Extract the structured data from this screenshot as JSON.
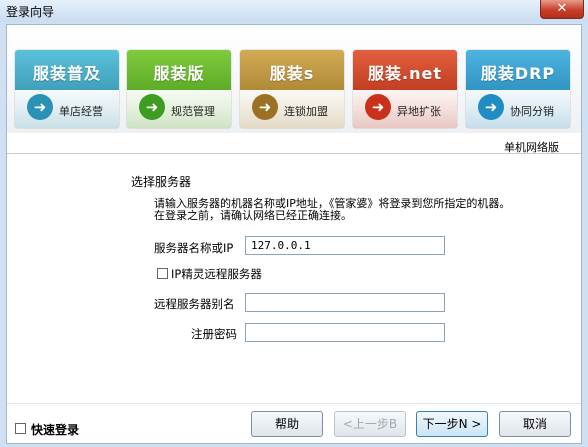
{
  "window": {
    "title": "登录向导",
    "close_glyph": "✕"
  },
  "tiles": [
    {
      "name": "服装普及",
      "sub": "单店经营",
      "color": "#5bc1d9",
      "dark": "#27819f",
      "circle": "#2a93b5"
    },
    {
      "name": "服装版",
      "sub": "规范管理",
      "color": "#7ecb3d",
      "dark": "#3f8f12",
      "circle": "#3d9d22"
    },
    {
      "name": "服装s",
      "sub": "连锁加盟",
      "color": "#d3ab54",
      "dark": "#8e6a1c",
      "circle": "#9b7224"
    },
    {
      "name": "服装.net",
      "sub": "异地扩张",
      "color": "#e25f3f",
      "dark": "#a51f0a",
      "circle": "#c9311a"
    },
    {
      "name": "服装DRP",
      "sub": "协同分销",
      "color": "#4db3e0",
      "dark": "#1779a9",
      "circle": "#1f8cc2"
    }
  ],
  "edition": "单机网络版",
  "form": {
    "section_title": "选择服务器",
    "hint_line1": "请输入服务器的机器名称或IP地址，《管家婆》将登录到您所指定的机器。",
    "hint_line2": "在登录之前，请确认网络已经正确连接。",
    "server_label": "服务器名称或IP",
    "server_value": "127.0.0.1",
    "elf_label": "IP精灵远程服务器",
    "elf_checked": false,
    "alias_label": "远程服务器别名",
    "alias_value": "",
    "code_label": "注册密码",
    "code_value": ""
  },
  "footer": {
    "quick_login": "快速登录",
    "quick_checked": false,
    "help": "帮助",
    "prev": "<上一步B",
    "next": "下一步N >",
    "cancel": "取消"
  }
}
